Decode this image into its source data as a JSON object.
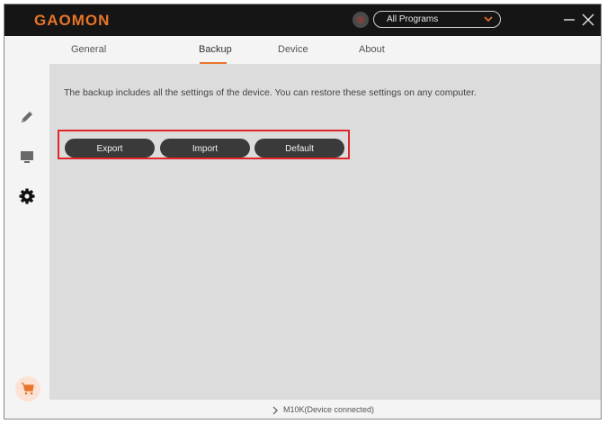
{
  "header": {
    "logo_text": "GAOMON",
    "program_select": {
      "value": "All Programs"
    }
  },
  "tabs": [
    {
      "label": "General"
    },
    {
      "label": "Backup",
      "active": true
    },
    {
      "label": "Device"
    },
    {
      "label": "About"
    }
  ],
  "sidebar": {
    "items": [
      {
        "icon": "pen-icon"
      },
      {
        "icon": "monitor-icon"
      },
      {
        "icon": "gear-icon",
        "active": true
      }
    ],
    "cart_icon": "shopping-cart-icon"
  },
  "backup": {
    "description": "The backup includes all the settings of the device. You can restore these settings on any computer.",
    "buttons": {
      "export_label": "Export",
      "import_label": "Import",
      "default_label": "Default"
    }
  },
  "status": {
    "device_text": "M10K(Device connected)"
  },
  "colors": {
    "accent": "#e8742a",
    "titlebar": "#151515",
    "button_bg": "#3a3a3a",
    "highlight_box": "#e0262b",
    "content_bg": "#dcdcdc"
  }
}
